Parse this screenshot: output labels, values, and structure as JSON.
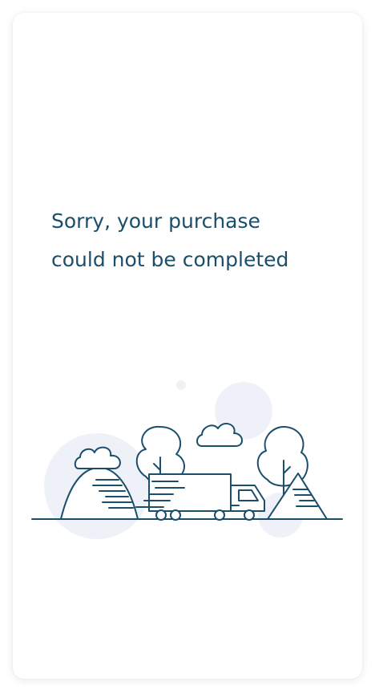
{
  "message": {
    "line1": "Sorry, your purchase",
    "line2": "could not be completed"
  },
  "illustration": {
    "icon": "delivery-truck-scene-icon",
    "stroke_color": "#1b4e6b",
    "bubble_color": "#eef2f8"
  }
}
